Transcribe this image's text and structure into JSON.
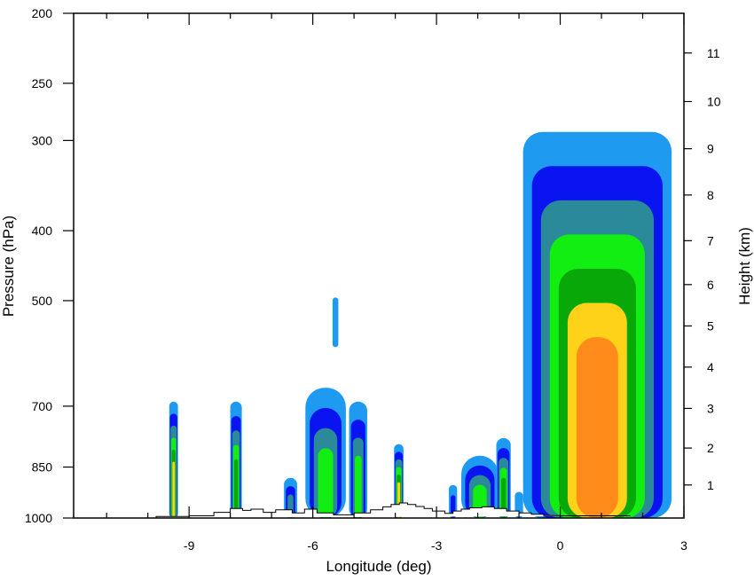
{
  "chart_data": {
    "type": "heatmap",
    "title": "",
    "xlabel": "Longitude (deg)",
    "ylabel": "Pressure (hPa)",
    "y2label": "Height (km)",
    "xlim": [
      -11.8,
      3.0
    ],
    "ylim": [
      1000,
      200
    ],
    "yscale": "log",
    "x_ticks": [
      -9,
      -6,
      -3,
      0,
      3
    ],
    "x_tick_labels": [
      "-9",
      "-6",
      "-3",
      "0",
      "3"
    ],
    "y_ticks": [
      200,
      250,
      300,
      400,
      500,
      700,
      850,
      1000
    ],
    "y_tick_labels": [
      "200",
      "250",
      "300",
      "400",
      "500",
      "700",
      "850",
      "1000"
    ],
    "y2_ticks_km": [
      1,
      2,
      3,
      4,
      5,
      6,
      7,
      8,
      9,
      10,
      11
    ],
    "y2_tick_labels": [
      "1",
      "2",
      "3",
      "4",
      "5",
      "6",
      "7",
      "8",
      "9",
      "10",
      "11"
    ],
    "y2_tick_pressure_hPa": [
      900,
      800,
      705,
      618,
      542,
      475,
      413,
      357,
      308,
      265,
      227
    ],
    "grid": false,
    "colors": {
      "level1": "#1e9bf0",
      "level2": "#0a14f0",
      "level3": "#2a8a9a",
      "level4": "#12ee12",
      "level5": "#08a808",
      "level6": "#ffd21a",
      "level7": "#ff8c1a",
      "axis": "#000000",
      "terrain": "#000000"
    },
    "terrain_hPa": {
      "lon": [
        -9.8,
        -9.0,
        -8.4,
        -8.0,
        -7.7,
        -7.5,
        -7.2,
        -6.9,
        -6.5,
        -6.2,
        -5.9,
        -5.5,
        -5.0,
        -4.6,
        -4.3,
        -4.1,
        -3.9,
        -3.7,
        -3.5,
        -3.3,
        -3.1,
        -2.8,
        -2.6,
        -2.4,
        -2.2,
        -1.9,
        -1.6,
        -1.3,
        -1.0,
        -0.7,
        -0.4,
        0.0,
        0.5,
        1.0,
        1.5
      ],
      "pressure": [
        995,
        993,
        982,
        970,
        976,
        972,
        982,
        974,
        984,
        972,
        984,
        990,
        984,
        974,
        965,
        958,
        953,
        958,
        964,
        970,
        978,
        985,
        978,
        972,
        968,
        965,
        970,
        978,
        984,
        988,
        992,
        993,
        993,
        993,
        993
      ]
    },
    "cells": [
      {
        "name": "cell-lon-minus-9.3",
        "lon_range": [
          -9.48,
          -9.27
        ],
        "p_top": 690,
        "max_level": 6
      },
      {
        "name": "cell-lon-minus-7.9",
        "lon_range": [
          -8.0,
          -7.72
        ],
        "p_top": 690,
        "max_level": 5
      },
      {
        "name": "cell-lon-minus-6.5",
        "lon_range": [
          -6.7,
          -6.38
        ],
        "p_top": 880,
        "max_level": 3
      },
      {
        "name": "cell-lon-minus-5.8",
        "lon_range": [
          -6.18,
          -5.2
        ],
        "p_top": 660,
        "max_level": 4
      },
      {
        "name": "cell-lon-minus-5.5-upper",
        "lon_range": [
          -5.52,
          -5.38
        ],
        "p_top": 495,
        "p_bottom": 580,
        "max_level": 1
      },
      {
        "name": "cell-lon-minus-4.9",
        "lon_range": [
          -5.12,
          -4.68
        ],
        "p_top": 690,
        "max_level": 4
      },
      {
        "name": "cell-lon-minus-3.9",
        "lon_range": [
          -4.03,
          -3.8
        ],
        "p_top": 790,
        "max_level": 6
      },
      {
        "name": "cell-lon-minus-2.6",
        "lon_range": [
          -2.7,
          -2.5
        ],
        "p_top": 900,
        "max_level": 2
      },
      {
        "name": "cell-lon-minus-1.9",
        "lon_range": [
          -2.4,
          -1.5
        ],
        "p_top": 820,
        "max_level": 4
      },
      {
        "name": "cell-lon-minus-1.4",
        "lon_range": [
          -1.55,
          -1.2
        ],
        "p_top": 775,
        "max_level": 5
      },
      {
        "name": "cell-lon-minus-1.0",
        "lon_range": [
          -1.1,
          -0.9
        ],
        "p_top": 920,
        "max_level": 1
      },
      {
        "name": "cell-lon-0-to-2.6",
        "lon_range": [
          -0.9,
          2.7
        ],
        "p_top": 292,
        "max_level": 7
      }
    ]
  }
}
